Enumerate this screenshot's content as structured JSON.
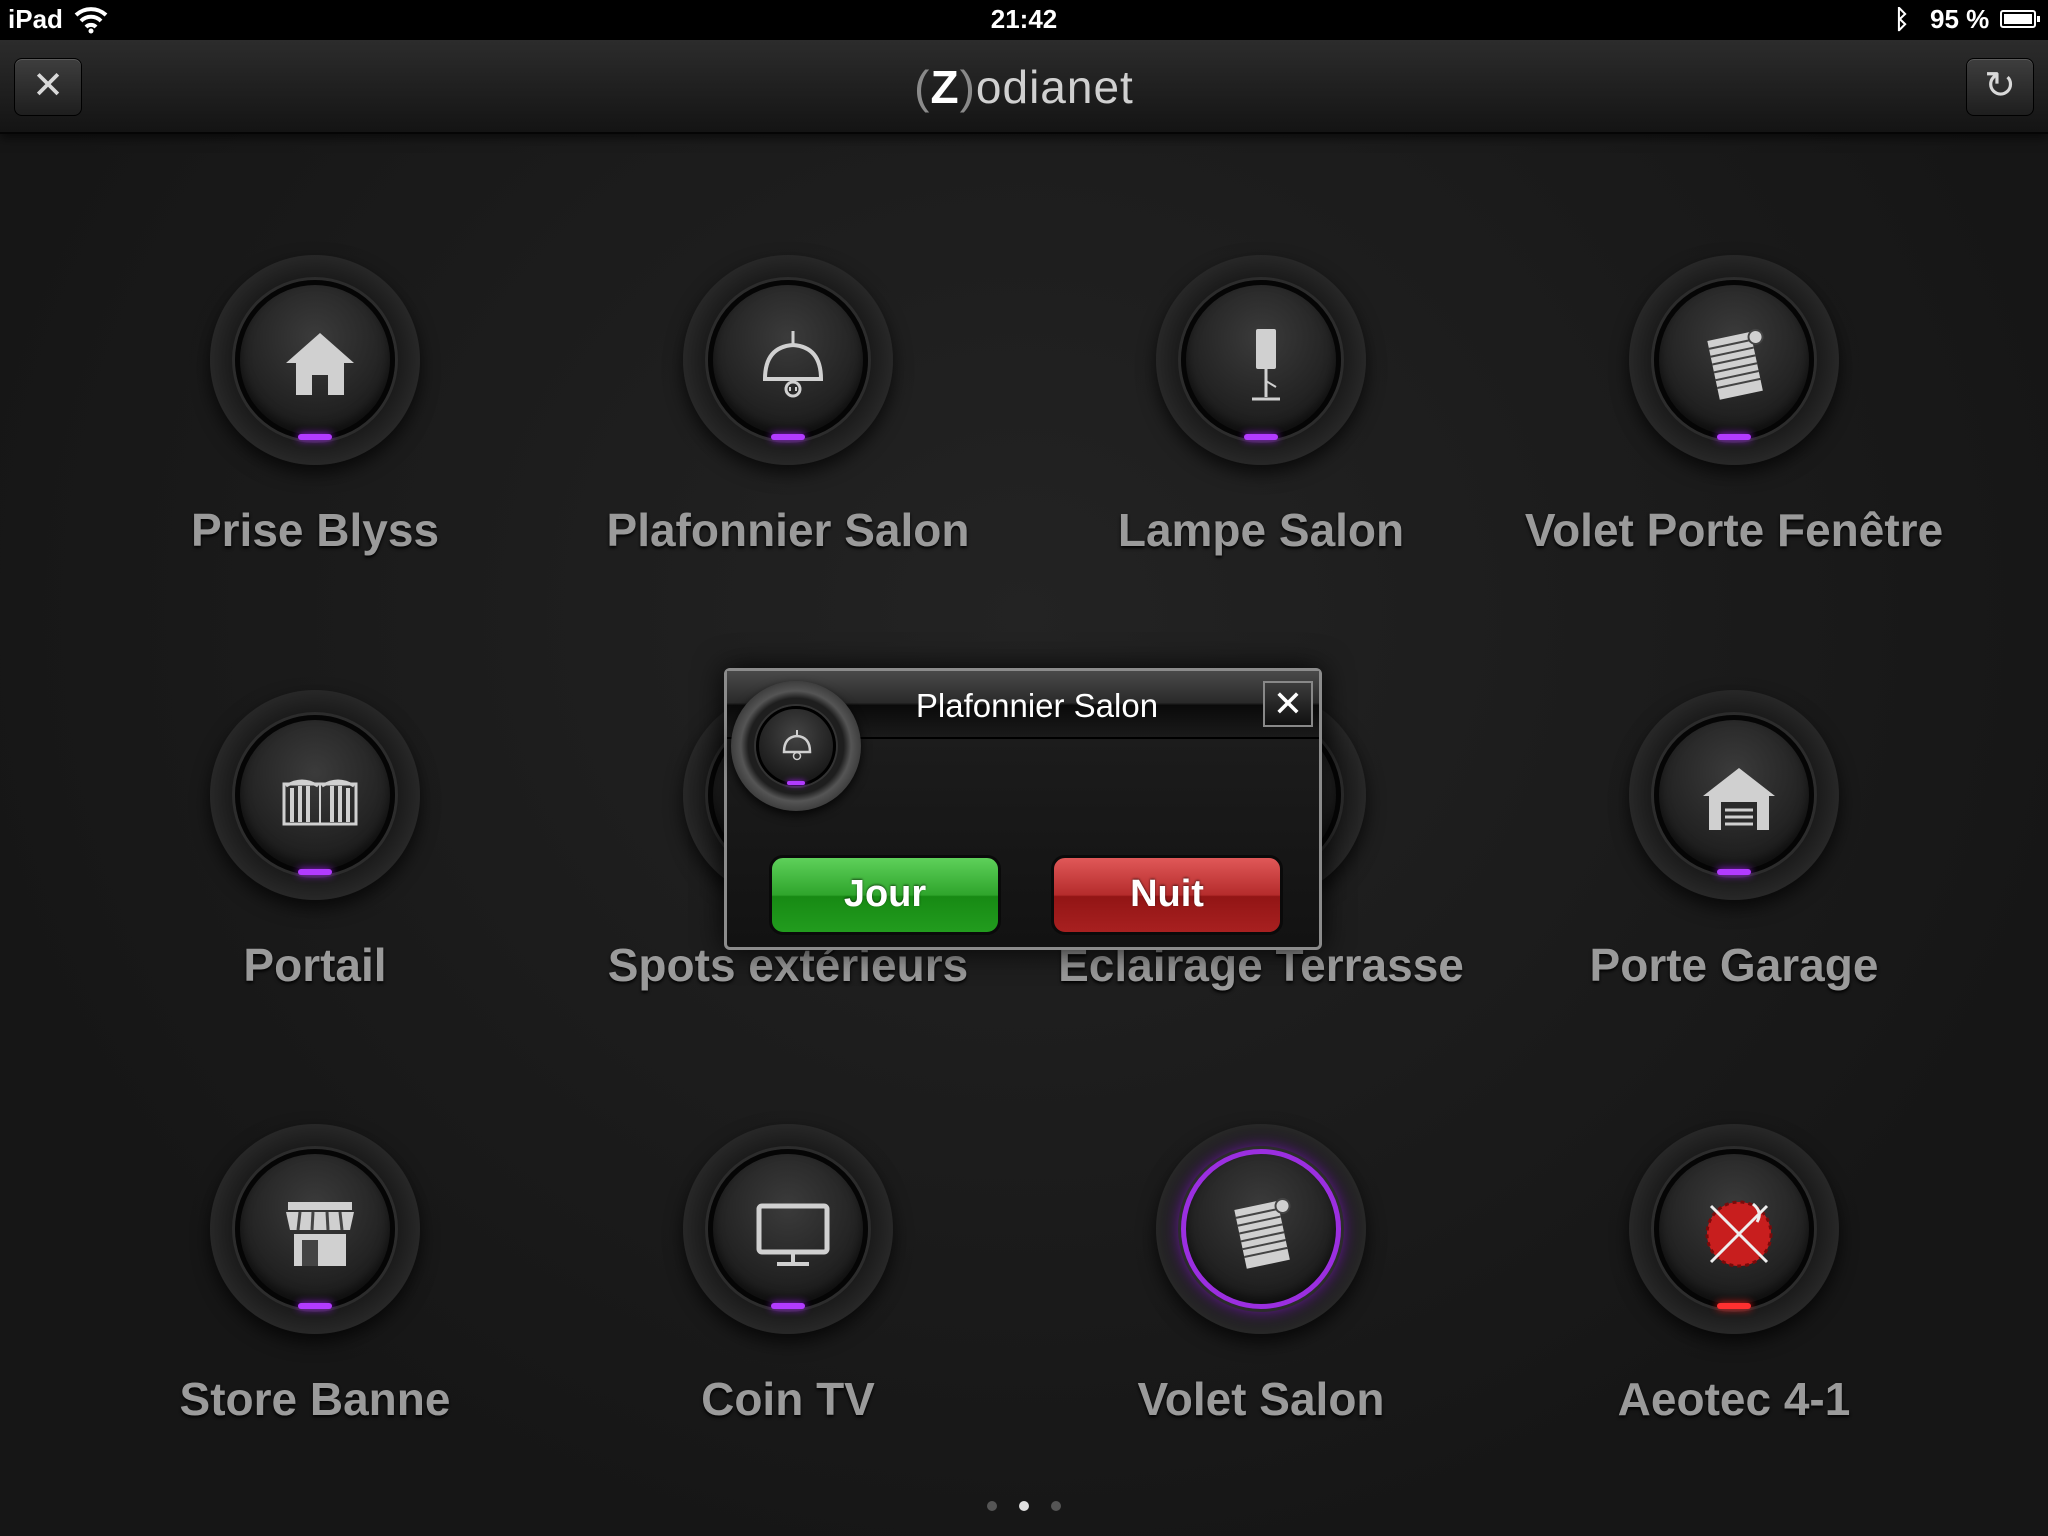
{
  "statusbar": {
    "device": "iPad",
    "time": "21:42",
    "battery": "95 %"
  },
  "navbar": {
    "logo_paren_left": "(",
    "logo_z": "Z",
    "logo_paren_right": ")",
    "logo_rest": "odianet",
    "close_icon": "✕",
    "refresh_icon": "↻"
  },
  "devices": [
    {
      "label": "Prise Blyss",
      "icon": "house-icon"
    },
    {
      "label": "Plafonnier Salon",
      "icon": "ceiling-lamp-icon"
    },
    {
      "label": "Lampe Salon",
      "icon": "floor-lamp-icon"
    },
    {
      "label": "Volet Porte Fenêtre",
      "icon": "shutter-icon"
    },
    {
      "label": "Portail",
      "icon": "gate-icon"
    },
    {
      "label": "Spots extérieurs",
      "icon": "ceiling-lamp-icon"
    },
    {
      "label": "Eclairage Terrasse",
      "icon": "ceiling-lamp-icon"
    },
    {
      "label": "Porte Garage",
      "icon": "garage-icon"
    },
    {
      "label": "Store Banne",
      "icon": "awning-icon"
    },
    {
      "label": "Coin TV",
      "icon": "tv-icon"
    },
    {
      "label": "Volet Salon",
      "icon": "shutter-icon"
    },
    {
      "label": "Aeotec 4-1",
      "icon": "sensor-disabled-icon"
    }
  ],
  "modal": {
    "title": "Plafonnier Salon",
    "close_icon": "✕",
    "jour_label": "Jour",
    "nuit_label": "Nuit"
  },
  "pager": {
    "count": 3,
    "active": 1
  },
  "colors": {
    "accent_glow": "#b23bff",
    "alert_glow": "#ff3030",
    "jour": "#2fa52c",
    "nuit": "#b52c2c"
  }
}
